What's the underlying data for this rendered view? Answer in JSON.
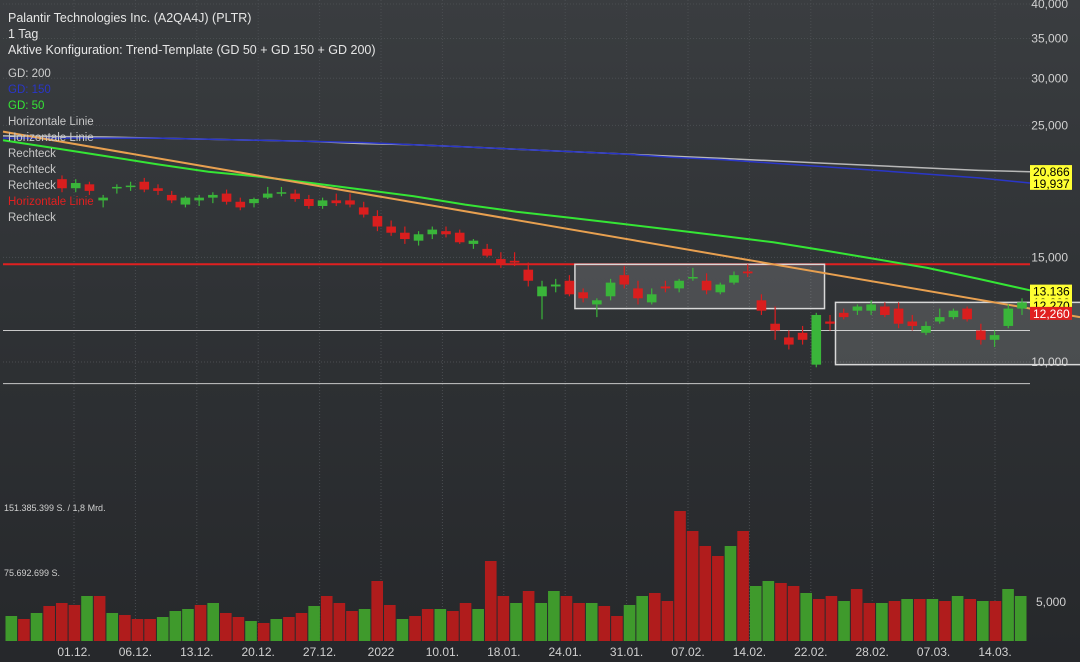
{
  "header": {
    "title": "Palantir Technologies Inc. (A2QA4J) (PLTR)",
    "interval": "1 Tag",
    "config": "Aktive Konfiguration: Trend-Template (GD 50 + GD 150 + GD 200)"
  },
  "legend": [
    {
      "label": "GD: 200",
      "color": "#cfcfcf"
    },
    {
      "label": "GD: 150",
      "color": "#2a36c8"
    },
    {
      "label": "GD: 50",
      "color": "#35e635"
    },
    {
      "label": "Horizontale Linie",
      "color": "#c8c8c8"
    },
    {
      "label": "Horizontale Linie",
      "color": "#c8c8c8"
    },
    {
      "label": "Rechteck",
      "color": "#c8c8c8"
    },
    {
      "label": "Rechteck",
      "color": "#c8c8c8"
    },
    {
      "label": "Rechteck",
      "color": "#c8c8c8"
    },
    {
      "label": "Horizontale Linie",
      "color": "#e02020"
    },
    {
      "label": "Rechteck",
      "color": "#c8c8c8"
    }
  ],
  "chart_data": {
    "type": "candlestick",
    "price_axis": {
      "scale": "log",
      "ticks": [
        40,
        35,
        30,
        25,
        15,
        10
      ],
      "tick_labels": [
        "40,000",
        "35,000",
        "30,000",
        "25,000",
        "15,000",
        "10,000"
      ],
      "range": [
        8.6,
        40
      ]
    },
    "x_labels": [
      "01.12.",
      "06.12.",
      "13.12.",
      "20.12.",
      "27.12.",
      "2022",
      "10.01.",
      "18.01.",
      "24.01.",
      "31.01.",
      "07.02.",
      "14.02.",
      "22.02.",
      "28.02.",
      "07.03.",
      "14.03."
    ],
    "candles": [
      {
        "o": 20.3,
        "h": 20.6,
        "l": 19.3,
        "c": 19.6
      },
      {
        "o": 19.6,
        "h": 20.3,
        "l": 19.3,
        "c": 20.0
      },
      {
        "o": 19.9,
        "h": 20.1,
        "l": 19.1,
        "c": 19.4
      },
      {
        "o": 18.7,
        "h": 19.1,
        "l": 18.2,
        "c": 18.9
      },
      {
        "o": 19.6,
        "h": 19.9,
        "l": 19.2,
        "c": 19.7
      },
      {
        "o": 19.7,
        "h": 20.1,
        "l": 19.4,
        "c": 19.8
      },
      {
        "o": 20.1,
        "h": 20.4,
        "l": 19.3,
        "c": 19.5
      },
      {
        "o": 19.6,
        "h": 19.9,
        "l": 19.1,
        "c": 19.4
      },
      {
        "o": 19.1,
        "h": 19.4,
        "l": 18.5,
        "c": 18.7
      },
      {
        "o": 18.4,
        "h": 19.0,
        "l": 18.2,
        "c": 18.9
      },
      {
        "o": 18.7,
        "h": 19.1,
        "l": 18.3,
        "c": 18.9
      },
      {
        "o": 18.9,
        "h": 19.3,
        "l": 18.5,
        "c": 19.1
      },
      {
        "o": 19.2,
        "h": 19.5,
        "l": 18.4,
        "c": 18.6
      },
      {
        "o": 18.6,
        "h": 18.9,
        "l": 18.0,
        "c": 18.2
      },
      {
        "o": 18.5,
        "h": 18.9,
        "l": 18.2,
        "c": 18.8
      },
      {
        "o": 18.9,
        "h": 19.7,
        "l": 18.8,
        "c": 19.2
      },
      {
        "o": 19.2,
        "h": 19.7,
        "l": 19.0,
        "c": 19.3
      },
      {
        "o": 19.2,
        "h": 19.5,
        "l": 18.6,
        "c": 18.8
      },
      {
        "o": 18.8,
        "h": 19.1,
        "l": 18.1,
        "c": 18.3
      },
      {
        "o": 18.3,
        "h": 18.9,
        "l": 18.1,
        "c": 18.7
      },
      {
        "o": 18.7,
        "h": 19.2,
        "l": 18.3,
        "c": 18.5
      },
      {
        "o": 18.7,
        "h": 19.2,
        "l": 18.2,
        "c": 18.4
      },
      {
        "o": 18.2,
        "h": 18.6,
        "l": 17.5,
        "c": 17.7
      },
      {
        "o": 17.6,
        "h": 18.0,
        "l": 16.6,
        "c": 16.9
      },
      {
        "o": 16.9,
        "h": 17.3,
        "l": 16.3,
        "c": 16.5
      },
      {
        "o": 16.5,
        "h": 16.9,
        "l": 15.8,
        "c": 16.1
      },
      {
        "o": 16.0,
        "h": 16.6,
        "l": 15.7,
        "c": 16.4
      },
      {
        "o": 16.4,
        "h": 16.9,
        "l": 16.1,
        "c": 16.7
      },
      {
        "o": 16.6,
        "h": 16.9,
        "l": 16.2,
        "c": 16.4
      },
      {
        "o": 16.5,
        "h": 16.7,
        "l": 15.8,
        "c": 15.9
      },
      {
        "o": 15.8,
        "h": 16.1,
        "l": 15.5,
        "c": 16.0
      },
      {
        "o": 15.5,
        "h": 15.8,
        "l": 15.0,
        "c": 15.1
      },
      {
        "o": 14.9,
        "h": 15.3,
        "l": 14.4,
        "c": 14.6
      },
      {
        "o": 14.8,
        "h": 15.3,
        "l": 14.5,
        "c": 14.7
      },
      {
        "o": 14.3,
        "h": 14.7,
        "l": 13.4,
        "c": 13.7
      },
      {
        "o": 12.9,
        "h": 13.7,
        "l": 11.8,
        "c": 13.4
      },
      {
        "o": 13.4,
        "h": 13.8,
        "l": 13.1,
        "c": 13.5
      },
      {
        "o": 13.7,
        "h": 14.0,
        "l": 12.9,
        "c": 13.0
      },
      {
        "o": 13.1,
        "h": 13.3,
        "l": 12.6,
        "c": 12.8
      },
      {
        "o": 12.5,
        "h": 12.8,
        "l": 11.9,
        "c": 12.7
      },
      {
        "o": 12.9,
        "h": 13.8,
        "l": 12.7,
        "c": 13.6
      },
      {
        "o": 14.0,
        "h": 14.5,
        "l": 13.3,
        "c": 13.5
      },
      {
        "o": 13.3,
        "h": 13.7,
        "l": 12.5,
        "c": 12.8
      },
      {
        "o": 12.6,
        "h": 13.3,
        "l": 12.5,
        "c": 13.0
      },
      {
        "o": 13.4,
        "h": 13.7,
        "l": 13.1,
        "c": 13.3
      },
      {
        "o": 13.3,
        "h": 13.8,
        "l": 13.1,
        "c": 13.7
      },
      {
        "o": 13.9,
        "h": 14.4,
        "l": 13.7,
        "c": 13.9
      },
      {
        "o": 13.7,
        "h": 14.1,
        "l": 13.0,
        "c": 13.2
      },
      {
        "o": 13.1,
        "h": 13.6,
        "l": 13.0,
        "c": 13.5
      },
      {
        "o": 13.6,
        "h": 14.2,
        "l": 13.5,
        "c": 14.0
      },
      {
        "o": 14.2,
        "h": 14.6,
        "l": 13.9,
        "c": 14.1
      },
      {
        "o": 12.7,
        "h": 13.0,
        "l": 12.0,
        "c": 12.2
      },
      {
        "o": 11.6,
        "h": 12.4,
        "l": 10.9,
        "c": 11.3
      },
      {
        "o": 11.0,
        "h": 11.3,
        "l": 10.5,
        "c": 10.7
      },
      {
        "o": 11.2,
        "h": 11.5,
        "l": 10.7,
        "c": 10.9
      },
      {
        "o": 9.9,
        "h": 12.1,
        "l": 9.8,
        "c": 12.0
      },
      {
        "o": 11.7,
        "h": 12.0,
        "l": 11.3,
        "c": 11.6
      },
      {
        "o": 12.1,
        "h": 12.3,
        "l": 11.8,
        "c": 11.9
      },
      {
        "o": 12.2,
        "h": 12.5,
        "l": 12.0,
        "c": 12.4
      },
      {
        "o": 12.2,
        "h": 12.7,
        "l": 12.0,
        "c": 12.5
      },
      {
        "o": 12.4,
        "h": 12.6,
        "l": 11.9,
        "c": 12.0
      },
      {
        "o": 12.3,
        "h": 12.6,
        "l": 11.4,
        "c": 11.6
      },
      {
        "o": 11.7,
        "h": 12.0,
        "l": 11.3,
        "c": 11.5
      },
      {
        "o": 11.2,
        "h": 11.7,
        "l": 11.1,
        "c": 11.5
      },
      {
        "o": 11.7,
        "h": 12.3,
        "l": 11.6,
        "c": 11.9
      },
      {
        "o": 11.9,
        "h": 12.3,
        "l": 11.8,
        "c": 12.2
      },
      {
        "o": 12.3,
        "h": 12.4,
        "l": 11.7,
        "c": 11.8
      },
      {
        "o": 11.3,
        "h": 11.6,
        "l": 10.7,
        "c": 10.9
      },
      {
        "o": 10.9,
        "h": 11.3,
        "l": 10.6,
        "c": 11.1
      },
      {
        "o": 11.5,
        "h": 12.5,
        "l": 11.4,
        "c": 12.3
      },
      {
        "o": 12.3,
        "h": 12.8,
        "l": 12.0,
        "c": 12.6
      }
    ],
    "moving_averages": [
      {
        "name": "GD 200",
        "color": "#b8b8b8",
        "values": [
          24.0,
          23.95,
          23.9,
          23.8,
          23.7,
          23.6,
          23.5,
          23.3,
          23.2,
          23.0,
          22.8,
          22.6,
          22.4,
          22.2,
          22.0,
          21.8,
          21.6,
          21.4,
          21.2,
          21.0,
          20.9
        ]
      },
      {
        "name": "GD 150",
        "color": "#2a36c8",
        "values": [
          23.8,
          23.8,
          23.8,
          23.8,
          23.7,
          23.6,
          23.5,
          23.4,
          23.2,
          23.0,
          22.8,
          22.6,
          22.4,
          22.1,
          21.9,
          21.6,
          21.3,
          21.0,
          20.7,
          20.4,
          20.0
        ]
      },
      {
        "name": "GD 50",
        "color": "#35e635",
        "values": [
          23.6,
          22.9,
          22.2,
          21.5,
          20.9,
          20.5,
          20.0,
          19.5,
          19.0,
          18.4,
          17.9,
          17.5,
          17.1,
          16.7,
          16.3,
          15.9,
          15.4,
          14.9,
          14.4,
          13.8,
          13.2
        ]
      }
    ],
    "trendline": {
      "color": "#e8a050",
      "start": 24.4,
      "end": 11.9
    },
    "horizontal_lines": [
      {
        "value": 14.6,
        "color": "#e02020"
      },
      {
        "value": 11.3,
        "color": "#c8c8c8"
      },
      {
        "value": 9.2,
        "color": "#c8c8c8"
      }
    ],
    "rectangles": [
      {
        "from": 38,
        "to": 55,
        "high": 14.6,
        "low": 12.3
      },
      {
        "from": 57,
        "to": 79,
        "high": 12.6,
        "low": 9.9
      },
      {
        "from": 79,
        "to": 81,
        "high": 12.9,
        "low": 11.9
      }
    ],
    "price_labels": [
      {
        "text": "20,866",
        "value": 20.866,
        "bg": "#ffff33"
      },
      {
        "text": "19,937",
        "value": 19.937,
        "bg": "#ffff33"
      },
      {
        "text": "13,136",
        "value": 13.136,
        "bg": "#ffff33"
      },
      {
        "text": "12,206",
        "value": 12.58,
        "bg": "#ffff33"
      },
      {
        "text": "12,270",
        "value": 12.42,
        "bg": "#ffff33"
      },
      {
        "text": "12,260",
        "value": 12.05,
        "bg": "#e02020"
      }
    ],
    "volume": {
      "labels": [
        "151.385.399 S. / 1,8 Mrd.",
        "75.692.699 S."
      ],
      "axis_label": "5,000",
      "values": [
        25,
        22,
        28,
        35,
        38,
        36,
        45,
        45,
        28,
        26,
        22,
        22,
        24,
        30,
        32,
        36,
        38,
        28,
        24,
        20,
        18,
        22,
        24,
        28,
        35,
        45,
        38,
        30,
        32,
        60,
        36,
        22,
        25,
        32,
        32,
        30,
        38,
        32,
        80,
        45,
        38,
        50,
        38,
        50,
        45,
        38,
        38,
        35,
        25,
        36,
        45,
        48,
        40,
        130,
        110,
        95,
        85,
        95,
        110,
        55,
        60,
        58,
        55,
        48,
        42,
        45,
        40,
        52,
        38,
        38,
        40,
        42,
        42,
        42,
        40,
        45,
        42,
        40,
        40,
        52,
        45
      ],
      "colors": [
        "g",
        "r",
        "g",
        "r",
        "r",
        "r",
        "g",
        "r",
        "g",
        "r",
        "r",
        "r",
        "g",
        "g",
        "g",
        "r",
        "g",
        "r",
        "r",
        "g",
        "r",
        "g",
        "r",
        "r",
        "g",
        "r",
        "r",
        "r",
        "g",
        "r",
        "r",
        "g",
        "r",
        "r",
        "g",
        "r",
        "r",
        "g",
        "r",
        "r",
        "g",
        "r",
        "g",
        "g",
        "r",
        "r",
        "g",
        "r",
        "r",
        "g",
        "g",
        "r",
        "r",
        "r",
        "r",
        "r",
        "r",
        "g",
        "r",
        "g",
        "g",
        "r",
        "r",
        "g",
        "r",
        "r",
        "g",
        "r",
        "r",
        "g",
        "r",
        "g",
        "r",
        "g",
        "r",
        "g",
        "r",
        "g",
        "r",
        "g",
        "g"
      ]
    }
  }
}
